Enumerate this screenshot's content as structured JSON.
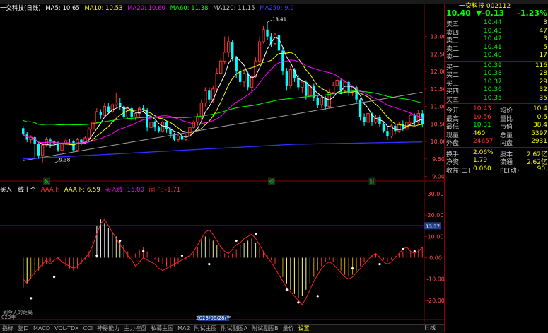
{
  "header": {
    "title": "一交科技(日线)",
    "ma5": "MA5: 10.65",
    "ma10": "MA10: 10.53",
    "ma20": "MA20: 10.60",
    "ma60": "MA60: 11.38",
    "ma120": "MA120: 11.15",
    "ma250": "MA250: 9.9"
  },
  "indicator_header": {
    "name": "买入一线十个",
    "aaa_up": "AAA上",
    "aaa_down": "AAA下: 6.59",
    "buy": "买入线: 15.00",
    "shape": "闸子: -1.71"
  },
  "colors": {
    "up": "#ff3232",
    "down": "#00ffff",
    "ma5": "#ffffff",
    "ma10": "#ffff00",
    "ma20": "#ff00ff",
    "ma60": "#00ff00",
    "ma120": "#a0a0a0",
    "ma250": "#3030ff",
    "magenta_line": "#ff00ff"
  },
  "chart_data": [
    {
      "type": "candlestick",
      "y_ticks": [
        "13.00",
        "12.50",
        "12.00",
        "11.50",
        "11.00",
        "10.50",
        "10.00",
        "9.50",
        "9.00"
      ],
      "ylim": [
        8.95,
        13.7
      ],
      "annotations": [
        {
          "label": "13.41",
          "x": 63,
          "y": 13.41
        },
        {
          "label": "9.38",
          "x": 8,
          "y": 9.38
        }
      ],
      "markers": [
        {
          "label": "跌",
          "x": 6
        },
        {
          "label": "顺",
          "x": 64
        },
        {
          "label": "财",
          "x": 90
        }
      ],
      "candles": [
        [
          10.38,
          10.2,
          10.45,
          10.15
        ],
        [
          10.2,
          10.05,
          10.28,
          9.98
        ],
        [
          10.05,
          10.12,
          10.18,
          9.95
        ],
        [
          10.12,
          9.92,
          10.15,
          9.55
        ],
        [
          9.92,
          9.6,
          9.98,
          9.5
        ],
        [
          9.6,
          9.9,
          9.95,
          9.38
        ],
        [
          9.9,
          10.05,
          10.12,
          9.85
        ],
        [
          10.05,
          10.0,
          10.1,
          9.82
        ],
        [
          10.0,
          9.95,
          10.05,
          9.8
        ],
        [
          9.95,
          9.75,
          10.0,
          9.7
        ],
        [
          9.75,
          9.95,
          10.0,
          9.7
        ],
        [
          9.95,
          10.02,
          10.08,
          9.9
        ],
        [
          10.02,
          10.0,
          10.08,
          9.9
        ],
        [
          10.0,
          9.75,
          10.05,
          9.7
        ],
        [
          9.75,
          10.05,
          10.1,
          9.72
        ],
        [
          10.05,
          9.98,
          10.08,
          9.9
        ],
        [
          9.98,
          10.1,
          10.15,
          9.92
        ],
        [
          10.1,
          10.35,
          10.4,
          10.05
        ],
        [
          10.35,
          10.55,
          10.62,
          10.3
        ],
        [
          10.55,
          10.85,
          10.95,
          10.5
        ],
        [
          10.85,
          10.75,
          10.92,
          10.65
        ],
        [
          10.75,
          11.0,
          11.1,
          10.7
        ],
        [
          11.0,
          10.85,
          11.1,
          10.8
        ],
        [
          10.85,
          11.05,
          11.1,
          10.8
        ],
        [
          11.05,
          11.1,
          11.4,
          11.0
        ],
        [
          11.1,
          11.0,
          11.25,
          10.9
        ],
        [
          11.0,
          10.7,
          11.05,
          10.65
        ],
        [
          10.7,
          10.95,
          11.0,
          10.65
        ],
        [
          10.95,
          10.7,
          11.0,
          10.6
        ],
        [
          10.7,
          10.8,
          10.85,
          10.6
        ],
        [
          10.8,
          10.95,
          11.0,
          10.7
        ],
        [
          10.95,
          10.9,
          11.05,
          10.85
        ],
        [
          10.9,
          10.4,
          10.95,
          10.3
        ],
        [
          10.4,
          10.55,
          10.62,
          10.35
        ],
        [
          10.55,
          10.4,
          10.6,
          10.3
        ],
        [
          10.4,
          10.3,
          10.45,
          10.25
        ],
        [
          10.3,
          10.55,
          10.6,
          10.25
        ],
        [
          10.55,
          10.35,
          10.6,
          10.25
        ],
        [
          10.35,
          10.2,
          10.4,
          10.1
        ],
        [
          10.2,
          10.05,
          10.25,
          10.0
        ],
        [
          10.05,
          10.15,
          10.2,
          9.98
        ],
        [
          10.15,
          10.05,
          10.2,
          9.98
        ],
        [
          10.05,
          10.15,
          10.2,
          10.0
        ],
        [
          10.15,
          10.4,
          10.5,
          10.1
        ],
        [
          10.4,
          10.55,
          10.6,
          10.35
        ],
        [
          10.55,
          10.7,
          10.8,
          10.45
        ],
        [
          10.7,
          11.1,
          11.2,
          10.6
        ],
        [
          11.1,
          11.45,
          11.55,
          11.0
        ],
        [
          11.45,
          11.2,
          11.55,
          11.1
        ],
        [
          11.2,
          11.5,
          11.6,
          11.1
        ],
        [
          11.5,
          11.95,
          12.1,
          11.45
        ],
        [
          11.95,
          12.3,
          12.4,
          11.9
        ],
        [
          12.3,
          12.55,
          13.0,
          12.2
        ],
        [
          12.55,
          12.85,
          13.0,
          12.4
        ],
        [
          12.85,
          12.4,
          12.9,
          12.3
        ],
        [
          12.4,
          12.0,
          12.45,
          11.8
        ],
        [
          12.0,
          11.7,
          12.1,
          11.6
        ],
        [
          11.7,
          11.95,
          12.0,
          11.55
        ],
        [
          11.95,
          11.55,
          12.0,
          11.45
        ],
        [
          11.55,
          11.85,
          11.9,
          11.4
        ],
        [
          11.85,
          12.3,
          12.4,
          11.8
        ],
        [
          12.3,
          12.85,
          13.0,
          12.2
        ],
        [
          12.85,
          13.2,
          13.3,
          12.8
        ],
        [
          13.2,
          13.0,
          13.41,
          12.9
        ],
        [
          13.0,
          12.8,
          13.1,
          12.7
        ],
        [
          12.8,
          13.05,
          13.1,
          12.75
        ],
        [
          13.05,
          12.6,
          13.1,
          12.5
        ],
        [
          12.6,
          12.0,
          12.7,
          11.9
        ],
        [
          12.0,
          11.6,
          12.1,
          11.45
        ],
        [
          11.6,
          12.05,
          12.15,
          11.5
        ],
        [
          12.05,
          11.8,
          12.1,
          11.7
        ],
        [
          11.8,
          11.55,
          11.9,
          11.45
        ],
        [
          11.55,
          11.7,
          11.75,
          11.4
        ],
        [
          11.7,
          11.3,
          11.75,
          11.2
        ],
        [
          11.3,
          11.6,
          11.65,
          11.25
        ],
        [
          11.6,
          11.25,
          11.65,
          11.15
        ],
        [
          11.25,
          11.05,
          11.3,
          10.95
        ],
        [
          11.05,
          11.25,
          11.3,
          10.95
        ],
        [
          11.25,
          11.0,
          11.3,
          10.9
        ],
        [
          11.0,
          11.4,
          11.5,
          10.95
        ],
        [
          11.4,
          11.6,
          11.7,
          11.35
        ],
        [
          11.6,
          11.75,
          11.85,
          11.5
        ],
        [
          11.75,
          11.45,
          11.8,
          11.35
        ],
        [
          11.45,
          11.7,
          11.75,
          11.4
        ],
        [
          11.7,
          11.4,
          11.75,
          11.3
        ],
        [
          11.4,
          11.55,
          11.6,
          11.3
        ],
        [
          11.55,
          11.2,
          11.6,
          11.1
        ],
        [
          11.2,
          10.7,
          11.25,
          10.6
        ],
        [
          10.7,
          10.55,
          10.8,
          10.45
        ],
        [
          10.55,
          10.8,
          10.85,
          10.5
        ],
        [
          10.8,
          10.55,
          10.85,
          10.45
        ],
        [
          10.55,
          10.7,
          10.75,
          10.5
        ],
        [
          10.7,
          10.5,
          10.75,
          10.4
        ],
        [
          10.5,
          10.3,
          10.55,
          10.25
        ],
        [
          10.3,
          10.15,
          10.4,
          10.05
        ],
        [
          10.15,
          10.45,
          10.5,
          10.1
        ],
        [
          10.45,
          10.3,
          10.5,
          10.2
        ],
        [
          10.3,
          10.5,
          10.55,
          10.25
        ],
        [
          10.5,
          10.35,
          10.6,
          10.3
        ],
        [
          10.35,
          10.55,
          10.6,
          10.3
        ],
        [
          10.55,
          10.75,
          10.8,
          10.5
        ],
        [
          10.75,
          10.55,
          10.8,
          10.45
        ],
        [
          10.55,
          10.8,
          10.9,
          10.5
        ],
        [
          10.8,
          10.5,
          10.9,
          10.4
        ]
      ]
    },
    {
      "type": "bar",
      "y_ticks": [
        "30.00",
        "20.00",
        "10.00",
        "0.00",
        "-10.00",
        "-20.00"
      ],
      "ylim": [
        -29,
        34
      ],
      "magenta_level": 15,
      "level_label": "13.37",
      "values": [
        -14,
        -12,
        -10,
        -8,
        -6,
        -4,
        -3,
        -2,
        -2,
        -1,
        -3,
        -4,
        -5,
        -6,
        -5,
        -3,
        -1,
        3,
        8,
        15,
        18,
        16,
        14,
        12,
        10,
        8,
        6,
        3,
        1,
        2,
        4,
        5,
        3,
        1,
        -1,
        -2,
        -3,
        -4,
        -5,
        -4,
        -3,
        -2,
        -1,
        1,
        3,
        5,
        8,
        10,
        9,
        8,
        6,
        4,
        2,
        1,
        2,
        4,
        6,
        7,
        8,
        9,
        7,
        5,
        3,
        1,
        -1,
        -3,
        -6,
        -9,
        -12,
        -15,
        -17,
        -19,
        -18,
        -15,
        -12,
        -9,
        -6,
        -4,
        -2,
        -1,
        -2,
        -4,
        -6,
        -8,
        -9,
        -8,
        -6,
        -4,
        -2,
        -1,
        1,
        2,
        1,
        -1,
        -2,
        -1,
        1,
        2,
        3,
        4,
        3,
        2,
        4,
        5
      ],
      "line": [
        -10,
        -12,
        -9,
        -7,
        -5,
        -3,
        -1,
        -3,
        -1,
        0,
        -2,
        -3,
        -4,
        -5,
        -4,
        -2,
        0,
        2,
        6,
        11,
        16,
        18,
        15,
        12,
        9,
        6,
        4,
        1,
        -1,
        -4,
        -2,
        0,
        -1,
        -2,
        -3,
        -5,
        -6,
        -5,
        -4,
        -3,
        -2,
        -1,
        0,
        1,
        3,
        6,
        9,
        12,
        13,
        11,
        8,
        5,
        3,
        2,
        4,
        6,
        7,
        9,
        10,
        11,
        9,
        6,
        3,
        0,
        -2,
        -5,
        -8,
        -11,
        -14,
        -16,
        -18,
        -20,
        -22,
        -19,
        -15,
        -11,
        -8,
        -5,
        -3,
        -2,
        -3,
        -5,
        -7,
        -9,
        -10,
        -9,
        -7,
        -5,
        -3,
        -1,
        1,
        2,
        0,
        -2,
        -3,
        -2,
        0,
        2,
        4,
        5,
        3,
        2,
        3,
        5
      ],
      "dots": [
        {
          "i": 2,
          "v": -19
        },
        {
          "i": 8,
          "v": -9
        },
        {
          "i": 19,
          "v": 1
        },
        {
          "i": 25,
          "v": 8
        },
        {
          "i": 31,
          "v": 3
        },
        {
          "i": 41,
          "v": 1
        },
        {
          "i": 48,
          "v": -3
        },
        {
          "i": 55,
          "v": 8
        },
        {
          "i": 60,
          "v": 11
        },
        {
          "i": 68,
          "v": -15
        },
        {
          "i": 71,
          "v": -21
        },
        {
          "i": 76,
          "v": -18
        },
        {
          "i": 85,
          "v": -5
        },
        {
          "i": 92,
          "v": -3
        },
        {
          "i": 98,
          "v": 4
        },
        {
          "i": 101,
          "v": 3
        }
      ]
    }
  ],
  "side": {
    "code": "一交科技 002112",
    "price": "10.40",
    "change": "▼-0.13",
    "pct": "-1.23%",
    "asks": [
      {
        "label": "卖五",
        "price": "10.44",
        "vol": "3"
      },
      {
        "label": "卖四",
        "price": "10.43",
        "vol": "47"
      },
      {
        "label": "卖三",
        "price": "10.42",
        "vol": "3"
      },
      {
        "label": "卖二",
        "price": "10.41",
        "vol": "5"
      },
      {
        "label": "卖一",
        "price": "10.40",
        "vol": "17"
      }
    ],
    "bids": [
      {
        "label": "买一",
        "price": "10.39",
        "vol": "116"
      },
      {
        "label": "买二",
        "price": "10.38",
        "vol": "28"
      },
      {
        "label": "买三",
        "price": "10.37",
        "vol": "29"
      },
      {
        "label": "买四",
        "price": "10.36",
        "vol": "32"
      },
      {
        "label": "买五",
        "price": "10.35",
        "vol": "35"
      }
    ],
    "stats": [
      {
        "k1": "今开",
        "v1": "10.43",
        "k2": "均价",
        "v2": "10.4"
      },
      {
        "k1": "最高",
        "v1": "10.56",
        "k2": "量比",
        "v2": "0.5"
      },
      {
        "k1": "最低",
        "v1": "10.31",
        "k2": "市值",
        "v2": "38.4"
      },
      {
        "k1": "现量",
        "v1": "460",
        "k2": "总量",
        "v2": "5397"
      },
      {
        "k1": "外盘",
        "v1": "24657",
        "k2": "内盘",
        "v2": "2931"
      }
    ],
    "stats2": [
      {
        "k1": "换手",
        "v1": "2.06%",
        "k2": "股本",
        "v2": "2.62亿"
      },
      {
        "k1": "净资",
        "v1": "1.79",
        "k2": "流通",
        "v2": "2.62亿"
      },
      {
        "k1": "收益(二)",
        "v1": "0.060",
        "k2": "PE(动)",
        "v2": "90."
      }
    ]
  },
  "bottom": {
    "left_label": "023年",
    "right_label": "到今天的距离",
    "date_flag": "2023/06/28/三",
    "tabs": [
      "指标",
      "复口",
      "MACD",
      "VOL-TDX",
      "CCI",
      "神秘能力",
      "主力控盘",
      "私募主图",
      "MA2",
      "附试主图",
      "附试副图A",
      "附试副图B",
      "量价",
      "设置"
    ],
    "right_tabs": [
      "日线"
    ]
  }
}
